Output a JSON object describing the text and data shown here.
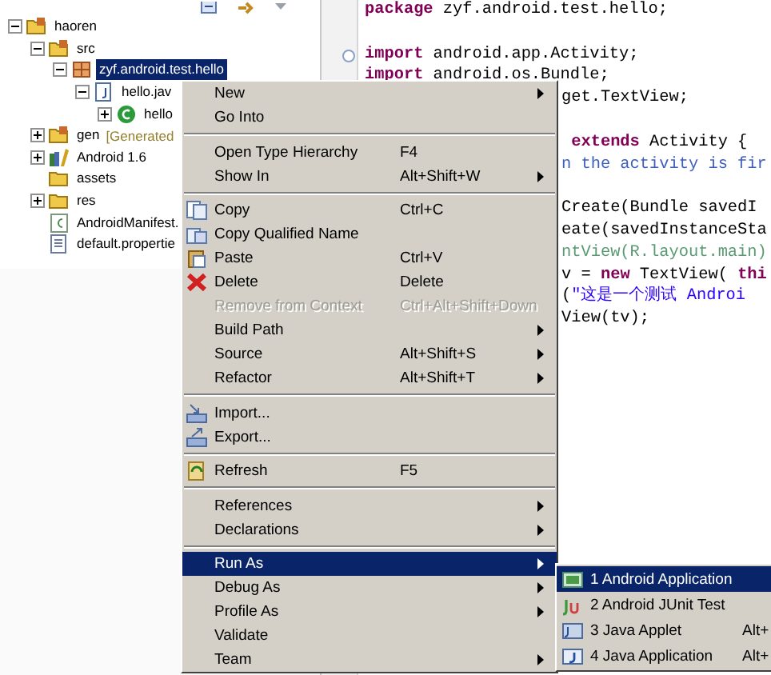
{
  "explorer": {
    "tree": [
      {
        "label": "haoren",
        "expanded": true,
        "selected": false,
        "children": [
          {
            "label": "src",
            "expanded": true,
            "selected": false,
            "children": [
              {
                "label": "zyf.android.test.hello",
                "expanded": true,
                "selected": true,
                "children": [
                  {
                    "label": "hello.jav",
                    "expanded": true,
                    "selected": false,
                    "children": [
                      {
                        "label": "hello",
                        "expanded": false,
                        "selected": false
                      }
                    ]
                  }
                ]
              }
            ]
          },
          {
            "label": "gen",
            "decoration": "[Generated",
            "expanded": false,
            "selected": false
          },
          {
            "label": "Android 1.6",
            "expanded": false,
            "selected": false
          },
          {
            "label": "assets",
            "selected": false
          },
          {
            "label": "res",
            "expanded": false,
            "selected": false
          },
          {
            "label": "AndroidManifest.",
            "selected": false
          },
          {
            "label": "default.propertie",
            "selected": false
          }
        ]
      }
    ]
  },
  "editor": {
    "lines": [
      {
        "kind": "full",
        "segments": [
          {
            "kind": "kw",
            "text": "package"
          },
          {
            "kind": "plain",
            "text": " zyf.android.test.hello;"
          }
        ]
      },
      {
        "kind": "full"
      },
      {
        "kind": "full",
        "fold": true,
        "segments": [
          {
            "kind": "kw",
            "text": "import"
          },
          {
            "kind": "plain",
            "text": " android.app.Activity;"
          }
        ]
      },
      {
        "kind": "full",
        "segments": [
          {
            "kind": "kw",
            "text": "import"
          },
          {
            "kind": "plain",
            "text": " android.os.Bundle;"
          }
        ]
      },
      {
        "kind": "partial",
        "segments": [
          {
            "kind": "plain",
            "text": "get.TextView;"
          }
        ]
      },
      {
        "kind": "partial"
      },
      {
        "kind": "partial",
        "segments": [
          {
            "kind": "kw",
            "text": " extends"
          },
          {
            "kind": "plain",
            "text": " Activity {"
          }
        ]
      },
      {
        "kind": "partial",
        "segments": [
          {
            "kind": "comment",
            "text": "n the activity is fir"
          }
        ]
      },
      {
        "kind": "partial"
      },
      {
        "kind": "partial",
        "segments": [
          {
            "kind": "plain",
            "text": "Create(Bundle savedI"
          }
        ]
      },
      {
        "kind": "partial",
        "segments": [
          {
            "kind": "plain",
            "text": "eate(savedInstanceSta"
          }
        ]
      },
      {
        "kind": "partial",
        "segments": [
          {
            "kind": "green",
            "text": "ntView(R.layout.main)"
          }
        ]
      },
      {
        "kind": "partial",
        "segments": [
          {
            "kind": "plain",
            "text": "v = "
          },
          {
            "kind": "kw",
            "text": "new"
          },
          {
            "kind": "plain",
            "text": " TextView( "
          },
          {
            "kind": "kw",
            "text": "thi"
          }
        ]
      },
      {
        "kind": "partial",
        "segments": [
          {
            "kind": "plain",
            "text": "("
          },
          {
            "kind": "string",
            "text": "\"这是一个测试 Androi"
          }
        ]
      },
      {
        "kind": "partial",
        "segments": [
          {
            "kind": "plain",
            "text": "View(tv);"
          }
        ]
      }
    ]
  },
  "context_menu": {
    "groups": [
      [
        {
          "label": "New",
          "submenu": true,
          "disabled": false,
          "selected": false
        },
        {
          "label": "Go Into",
          "submenu": false,
          "disabled": false,
          "selected": false
        }
      ],
      [
        {
          "label": "Open Type Hierarchy",
          "shortcut": "F4",
          "submenu": false,
          "disabled": false,
          "selected": false
        },
        {
          "label": "Show In",
          "shortcut": "Alt+Shift+W",
          "submenu": true,
          "disabled": false,
          "selected": false
        }
      ],
      [
        {
          "label": "Copy",
          "shortcut": "Ctrl+C",
          "submenu": false,
          "disabled": false,
          "selected": false
        },
        {
          "label": "Copy Qualified Name",
          "submenu": false,
          "disabled": false,
          "selected": false
        },
        {
          "label": "Paste",
          "shortcut": "Ctrl+V",
          "submenu": false,
          "disabled": false,
          "selected": false
        },
        {
          "label": "Delete",
          "shortcut": "Delete",
          "submenu": false,
          "disabled": false,
          "selected": false
        },
        {
          "label": "Remove from Context",
          "shortcut": "Ctrl+Alt+Shift+Down",
          "submenu": false,
          "disabled": true,
          "selected": false
        },
        {
          "label": "Build Path",
          "submenu": true,
          "disabled": false,
          "selected": false
        },
        {
          "label": "Source",
          "shortcut": "Alt+Shift+S",
          "submenu": true,
          "disabled": false,
          "selected": false
        },
        {
          "label": "Refactor",
          "shortcut": "Alt+Shift+T",
          "submenu": true,
          "disabled": false,
          "selected": false
        }
      ],
      [
        {
          "label": "Import...",
          "submenu": false,
          "disabled": false,
          "selected": false
        },
        {
          "label": "Export...",
          "submenu": false,
          "disabled": false,
          "selected": false
        }
      ],
      [
        {
          "label": "Refresh",
          "shortcut": "F5",
          "submenu": false,
          "disabled": false,
          "selected": false
        }
      ],
      [
        {
          "label": "References",
          "submenu": true,
          "disabled": false,
          "selected": false
        },
        {
          "label": "Declarations",
          "submenu": true,
          "disabled": false,
          "selected": false
        }
      ],
      [
        {
          "label": "Run As",
          "submenu": true,
          "disabled": false,
          "selected": true
        },
        {
          "label": "Debug As",
          "submenu": true,
          "disabled": false,
          "selected": false
        },
        {
          "label": "Profile As",
          "submenu": true,
          "disabled": false,
          "selected": false
        },
        {
          "label": "Validate",
          "submenu": false,
          "disabled": false,
          "selected": false
        },
        {
          "label": "Team",
          "submenu": true,
          "disabled": false,
          "selected": false
        }
      ]
    ]
  },
  "run_as_submenu": {
    "items": [
      {
        "label": "1 Android Application",
        "selected": true
      },
      {
        "label": "2 Android JUnit Test",
        "selected": false
      },
      {
        "label": "3 Java Applet",
        "shortcut": "Alt+",
        "selected": false
      },
      {
        "label": "4 Java Application",
        "shortcut": "Alt+",
        "selected": false
      }
    ]
  }
}
